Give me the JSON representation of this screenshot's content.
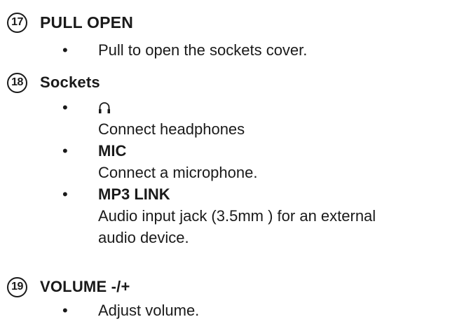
{
  "sections": [
    {
      "number": "17",
      "title": "PULL OPEN",
      "items": [
        {
          "label": "",
          "text": "Pull to open the sockets cover."
        }
      ]
    },
    {
      "number": "18",
      "title": "Sockets",
      "items": [
        {
          "icon": "headphones-icon",
          "label": "",
          "text": "Connect headphones"
        },
        {
          "label": "MIC",
          "text": "Connect a microphone."
        },
        {
          "label": "MP3 LINK",
          "text_line1": "Audio input jack (3.5mm ) for an external",
          "text_line2": "audio device."
        }
      ]
    },
    {
      "number": "19",
      "title": "VOLUME -/+",
      "items": [
        {
          "label": "",
          "text": "Adjust volume."
        }
      ]
    }
  ],
  "bullet_char": "•"
}
